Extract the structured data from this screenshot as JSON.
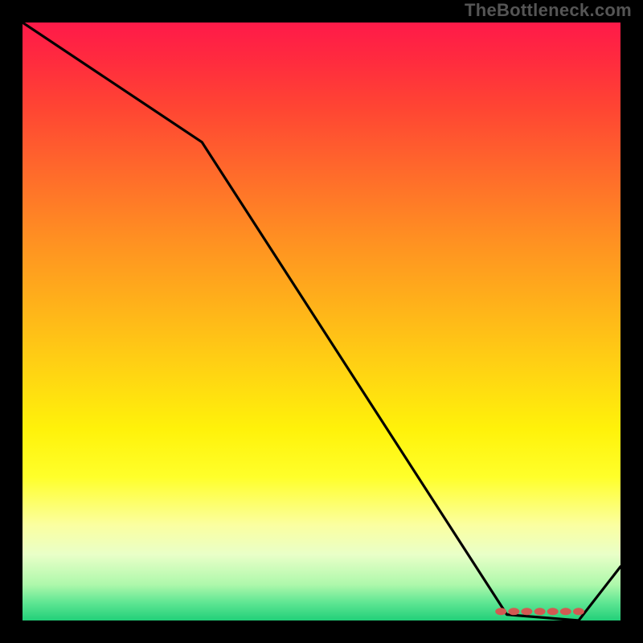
{
  "attribution": "TheBottleneck.com",
  "colors": {
    "frame_bg": "#000000",
    "line": "#000000",
    "marker": "#d25a52",
    "gradient_top": "#ff1a49",
    "gradient_bottom": "#22d079"
  },
  "chart_data": {
    "type": "line",
    "title": "",
    "xlabel": "",
    "ylabel": "",
    "xlim": [
      0,
      100
    ],
    "ylim": [
      0,
      100
    ],
    "grid": false,
    "x": [
      0,
      30,
      81,
      93,
      100
    ],
    "values": [
      100,
      80,
      1,
      0,
      9
    ],
    "markers": {
      "x_range": [
        80,
        93
      ],
      "y": 1.5,
      "count": 7
    },
    "note": "Values are read in percent of plot area; y=0 is bottom (green), y=100 is top (red). The dense dotted segment near the trough is approximated by 7 markers between x≈80 and x≈93."
  }
}
